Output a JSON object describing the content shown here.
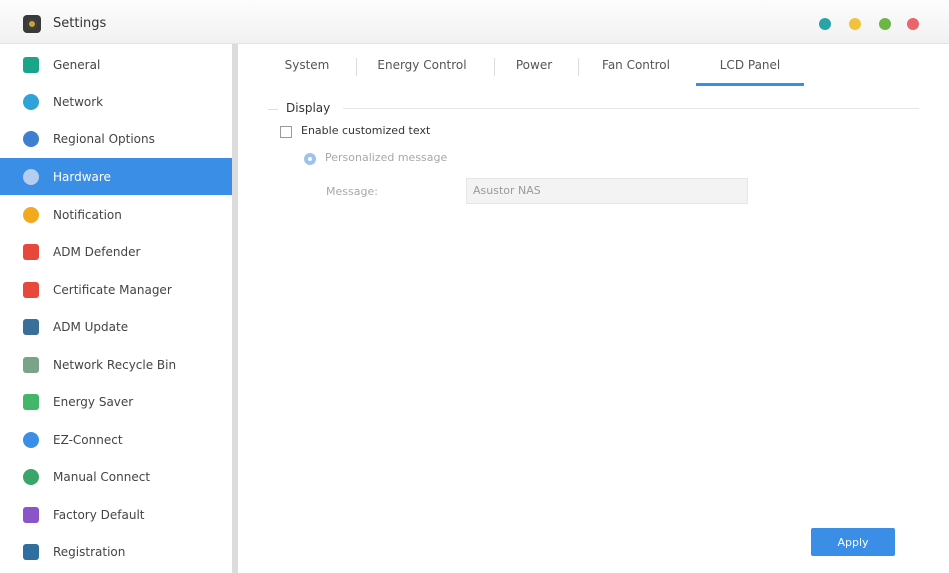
{
  "window": {
    "title": "Settings"
  },
  "window_controls": [
    {
      "name": "teal-dot",
      "color": "#2aa3a6"
    },
    {
      "name": "yellow-dot",
      "color": "#f2c33a"
    },
    {
      "name": "green-dot",
      "color": "#6db545"
    },
    {
      "name": "red-dot",
      "color": "#e9656a"
    }
  ],
  "sidebar": {
    "items": [
      {
        "label": "General",
        "icon": "general-icon",
        "color": "#1aa589"
      },
      {
        "label": "Network",
        "icon": "network-globe-icon",
        "color": "#2fa3d8"
      },
      {
        "label": "Regional Options",
        "icon": "regional-options-icon",
        "color": "#3f7fcf"
      },
      {
        "label": "Hardware",
        "icon": "hardware-icon",
        "color": "#b5cdef",
        "active": true
      },
      {
        "label": "Notification",
        "icon": "notification-icon",
        "color": "#f3a91d"
      },
      {
        "label": "ADM Defender",
        "icon": "adm-defender-icon",
        "color": "#e8483b"
      },
      {
        "label": "Certificate Manager",
        "icon": "certificate-manager-icon",
        "color": "#e8483b"
      },
      {
        "label": "ADM Update",
        "icon": "adm-update-icon",
        "color": "#3a6f9a"
      },
      {
        "label": "Network Recycle Bin",
        "icon": "recycle-bin-icon",
        "color": "#7aa38a"
      },
      {
        "label": "Energy Saver",
        "icon": "energy-saver-icon",
        "color": "#43b66a"
      },
      {
        "label": "EZ-Connect",
        "icon": "ez-connect-icon",
        "color": "#3a8ee6"
      },
      {
        "label": "Manual Connect",
        "icon": "manual-connect-icon",
        "color": "#3aa56b"
      },
      {
        "label": "Factory Default",
        "icon": "factory-default-icon",
        "color": "#8a55c8"
      },
      {
        "label": "Registration",
        "icon": "registration-icon",
        "color": "#2f6f9f"
      }
    ]
  },
  "tabs": [
    {
      "label": "System"
    },
    {
      "label": "Energy Control"
    },
    {
      "label": "Power"
    },
    {
      "label": "Fan Control"
    },
    {
      "label": "LCD Panel",
      "active": true
    }
  ],
  "display": {
    "section_title": "Display",
    "enable_checkbox_label": "Enable customized text",
    "enable_checked": false,
    "radio_label": "Personalized message",
    "message_label": "Message:",
    "message_value": "Asustor NAS"
  },
  "actions": {
    "apply_label": "Apply"
  },
  "colors": {
    "accent": "#3a8ee6"
  }
}
